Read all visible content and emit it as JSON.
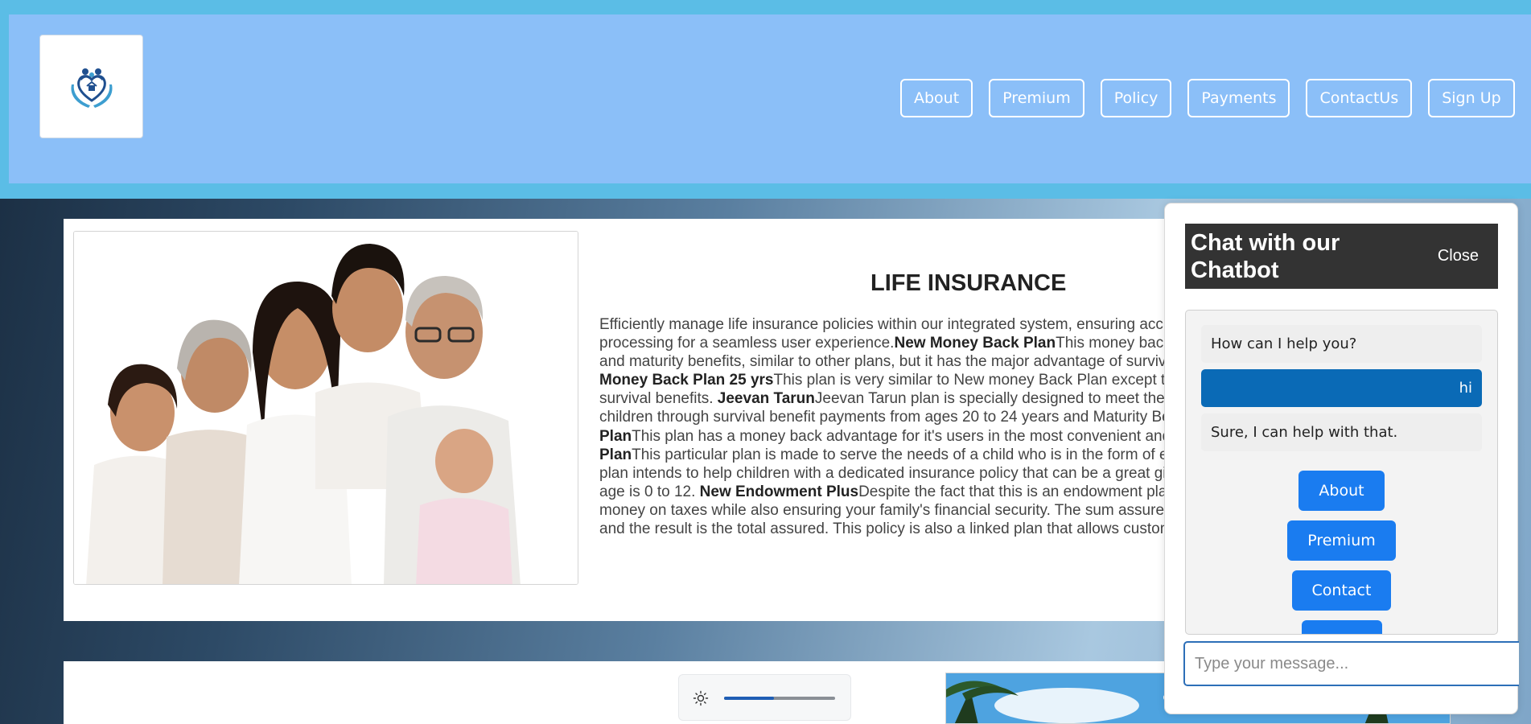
{
  "colors": {
    "header_band": "#5bbde6",
    "header_panel": "#8bbff8",
    "chat_header": "#333333",
    "user_bubble": "#0a6ab6",
    "option_button": "#1a7cf0"
  },
  "header": {
    "logo_icon": "family-heart-hands-logo",
    "nav": [
      "About",
      "Premium",
      "Policy",
      "Payments",
      "ContactUs",
      "Sign Up"
    ]
  },
  "card": {
    "title": "LIFE INSURANCE",
    "image_icon": "family-photo",
    "paragraphs": [
      {
        "bold": "",
        "text": "Efficiently manage life insurance policies within our integrated system, ensuring accurate premium tracking, and claims processing for a seamless user experience."
      },
      {
        "bold": "New Money Back Plan",
        "text": "This money back plan comes with not only death benefits and maturity benefits, similar to other plans, but it has the major advantage of survival benefits as well as optional benefits."
      },
      {
        "bold": "New Money Back Plan 25 yrs",
        "text": "This plan is very similar to New money Back Plan except the difference in Term and the years for survival benefits. "
      },
      {
        "bold": "Jeevan Tarun",
        "text": "Jeevan Tarun plan is specially designed to meet the educational and other needs of growing children through survival benefit payments from ages 20 to 24 years and Maturity Benefit at the age of 25 years. "
      },
      {
        "bold": "Money Back Plan",
        "text": "This plan has a money back advantage for it's users in the most convenient and easy way. "
      },
      {
        "bold": "New Children's Money Back Plan",
        "text": "This particular plan is made to serve the needs of a child who is in the form of education or nurture his skills at a sport. This plan intends to help children with a dedicated insurance policy that can be a great gift for your child is meant for children whose age is 0 to 12. "
      },
      {
        "bold": "New Endowment Plus",
        "text": "Despite the fact that this is an endowment plan, it is also a linked plan that helps you save money on taxes while also ensuring your family's financial security. The sum assured: The yearly premium is multiplied by ten, and the result is the total assured. This policy is also a linked plan that allows customers to invest through their insurance."
      }
    ]
  },
  "brightness": {
    "icon": "sun-icon",
    "level": 0.45
  },
  "chat": {
    "title": "Chat with our Chatbot",
    "close_label": "Close",
    "messages": [
      {
        "from": "bot",
        "text": "How can I help you?"
      },
      {
        "from": "user",
        "text": "hi"
      },
      {
        "from": "bot",
        "text": "Sure, I can help with that."
      }
    ],
    "options": [
      "About",
      "Premium",
      "Contact"
    ],
    "input_placeholder": "Type your message..."
  }
}
